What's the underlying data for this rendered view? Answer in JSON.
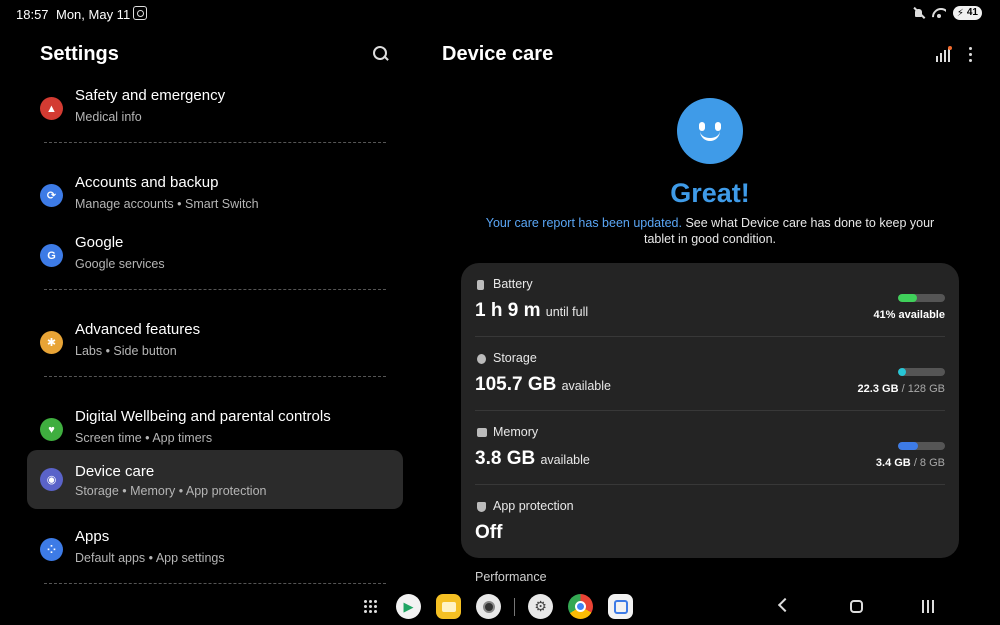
{
  "status_bar": {
    "time": "18:57",
    "date": "Mon, May 11",
    "battery_level": "41"
  },
  "left": {
    "title": "Settings",
    "items": [
      {
        "title": "Safety and emergency",
        "subtitle": "Medical info",
        "icon": "alert-icon",
        "color": "#d33b32"
      },
      {
        "title": "Accounts and backup",
        "subtitle": "Manage accounts  •  Smart Switch",
        "icon": "sync-icon",
        "color": "#3d7be6"
      },
      {
        "title": "Google",
        "subtitle": "Google services",
        "icon": "google-icon",
        "color": "#3d7be6"
      },
      {
        "title": "Advanced features",
        "subtitle": "Labs  •  Side button",
        "icon": "gear-plus-icon",
        "color": "#e8a436"
      },
      {
        "title": "Digital Wellbeing and parental controls",
        "subtitle": "Screen time  •  App timers",
        "icon": "wellbeing-icon",
        "color": "#3fae3f"
      },
      {
        "title": "Device care",
        "subtitle": "Storage  •  Memory  •  App protection",
        "icon": "device-care-icon",
        "color": "#5a63c9"
      },
      {
        "title": "Apps",
        "subtitle": "Default apps  •  App settings",
        "icon": "apps-icon",
        "color": "#3d7be6"
      }
    ]
  },
  "right": {
    "title": "Device care",
    "status": "Great!",
    "report_link": "Your care report has been updated.",
    "report_text": " See what Device care has done to keep your tablet in good condition.",
    "battery": {
      "label": "Battery",
      "value": "1 h 9 m",
      "unit": "until full",
      "meta": "41% available",
      "level": 0.41,
      "color": "#3fd05a"
    },
    "storage": {
      "label": "Storage",
      "value": "105.7 GB",
      "unit": "available",
      "used": "22.3 GB",
      "total": "/ 128 GB",
      "level": 0.17,
      "color": "#27c6d6"
    },
    "memory": {
      "label": "Memory",
      "value": "3.8 GB",
      "unit": "available",
      "used": "3.4 GB",
      "total": "/ 8 GB",
      "level": 0.43,
      "color": "#3d7be6"
    },
    "protection": {
      "label": "App protection",
      "value": "Off"
    },
    "performance_label": "Performance"
  },
  "taskbar": {
    "apps": [
      "play-store-icon",
      "my-files-icon",
      "camera-icon",
      "settings-icon",
      "chrome-icon",
      "calendar-icon"
    ]
  }
}
